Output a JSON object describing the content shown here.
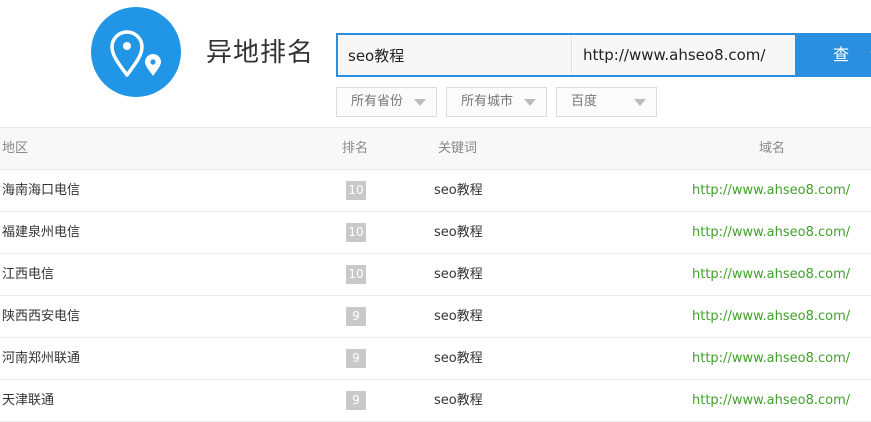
{
  "header": {
    "title": "异地排名",
    "keyword_value": "seo教程",
    "url_value": "http://www.ahseo8.com/",
    "query_label": "查 询"
  },
  "filters": [
    {
      "label": "所有省份"
    },
    {
      "label": "所有城市"
    },
    {
      "label": "百度"
    }
  ],
  "table": {
    "columns": [
      "地区",
      "排名",
      "关键词",
      "域名"
    ],
    "rows": [
      {
        "region": "海南海口电信",
        "rank": "10",
        "keyword": "seo教程",
        "domain": "http://www.ahseo8.com/"
      },
      {
        "region": "福建泉州电信",
        "rank": "10",
        "keyword": "seo教程",
        "domain": "http://www.ahseo8.com/"
      },
      {
        "region": "江西电信",
        "rank": "10",
        "keyword": "seo教程",
        "domain": "http://www.ahseo8.com/"
      },
      {
        "region": "陕西西安电信",
        "rank": "9",
        "keyword": "seo教程",
        "domain": "http://www.ahseo8.com/"
      },
      {
        "region": "河南郑州联通",
        "rank": "9",
        "keyword": "seo教程",
        "domain": "http://www.ahseo8.com/"
      },
      {
        "region": "天津联通",
        "rank": "9",
        "keyword": "seo教程",
        "domain": "http://www.ahseo8.com/"
      }
    ]
  },
  "colors": {
    "brand": "#2196e6",
    "button": "#2b8fe0",
    "link": "#3fa22a",
    "rank_badge": "#c9c9c9"
  },
  "icons": {
    "logo": "location-pins-icon",
    "dropdown": "caret-down-icon"
  }
}
